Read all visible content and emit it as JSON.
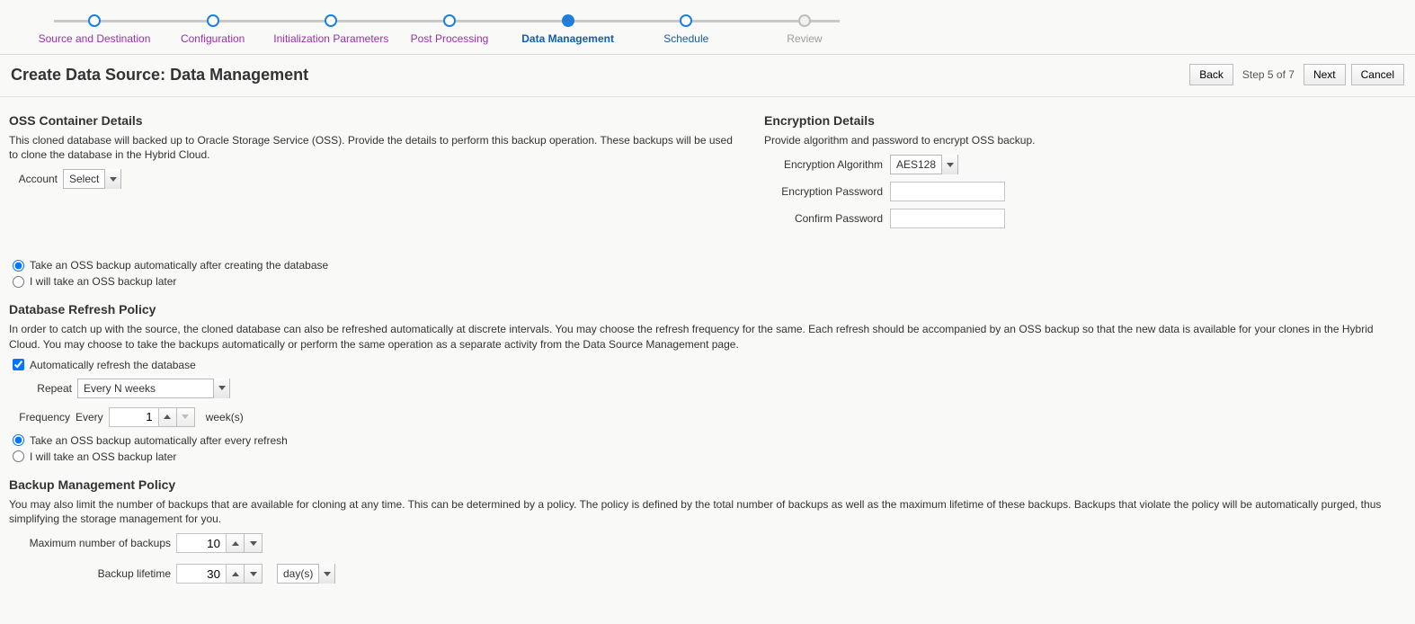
{
  "wizard": {
    "steps": [
      {
        "label": "Source and Destination",
        "state": "done"
      },
      {
        "label": "Configuration",
        "state": "done"
      },
      {
        "label": "Initialization Parameters",
        "state": "done"
      },
      {
        "label": "Post Processing",
        "state": "done"
      },
      {
        "label": "Data Management",
        "state": "current"
      },
      {
        "label": "Schedule",
        "state": "future"
      },
      {
        "label": "Review",
        "state": "inactive"
      }
    ]
  },
  "header": {
    "title": "Create Data Source: Data Management",
    "back": "Back",
    "step_text": "Step 5 of 7",
    "next": "Next",
    "cancel": "Cancel"
  },
  "oss": {
    "title": "OSS Container Details",
    "desc": "This cloned database will backed up to Oracle Storage Service (OSS). Provide the details to perform this backup operation. These backups will be used to clone the database in the Hybrid Cloud.",
    "account_label": "Account",
    "account_value": "Select",
    "radio_auto": "Take an OSS backup automatically after creating the database",
    "radio_later": "I will take an OSS backup later",
    "radio_selected": "auto"
  },
  "enc": {
    "title": "Encryption Details",
    "desc": "Provide algorithm and password to encrypt OSS backup.",
    "algo_label": "Encryption Algorithm",
    "algo_value": "AES128",
    "pwd_label": "Encryption Password",
    "confirm_label": "Confirm Password"
  },
  "refresh": {
    "title": "Database Refresh Policy",
    "desc": "In order to catch up with the source, the cloned database can also be refreshed automatically at discrete intervals. You may choose the refresh frequency for the same. Each refresh should be accompanied by an OSS backup so that the new data is available for your clones in the Hybrid Cloud. You may choose to take the backups automatically or perform the same operation as a separate activity from the Data Source Management page.",
    "auto_check_label": "Automatically refresh the database",
    "auto_checked": true,
    "repeat_label": "Repeat",
    "repeat_value": "Every N weeks",
    "frequency_label": "Frequency",
    "frequency_prefix": "Every",
    "frequency_value": "1",
    "frequency_unit": "week(s)",
    "radio_auto": "Take an OSS backup automatically after every refresh",
    "radio_later": "I will take an OSS backup later",
    "radio_selected": "auto"
  },
  "backup_policy": {
    "title": "Backup Management Policy",
    "desc": "You may also limit the number of backups that are available for cloning at any time. This can be determined by a policy. The policy is defined by the total number of backups as well as the maximum lifetime of these backups. Backups that violate the policy will be automatically purged, thus simplifying the storage management for you.",
    "max_label": "Maximum number of backups",
    "max_value": "10",
    "lifetime_label": "Backup lifetime",
    "lifetime_value": "30",
    "lifetime_unit": "day(s)"
  }
}
